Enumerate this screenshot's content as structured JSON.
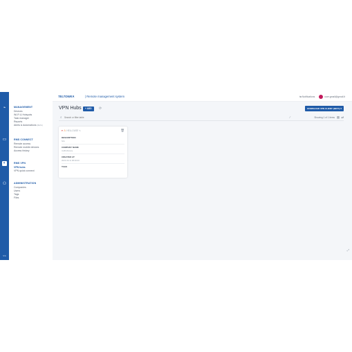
{
  "header": {
    "logo_text": "TELTONIKA",
    "app_title": "| Remote management system",
    "notifications_label": "Notifications",
    "user_email": "user.gmail@gmail.lt"
  },
  "sidebar": {
    "sections": [
      {
        "title": "MANAGEMENT",
        "items": [
          "Devices",
          "Wi-Fi & Hotspots",
          "Task manager",
          "Reports"
        ],
        "last_item": "Alerts & Automations",
        "beta": "(BETA)"
      },
      {
        "title": "RMS CONNECT",
        "items": [
          "Remote access",
          "Remote mobile devices",
          "Access history"
        ]
      },
      {
        "title": "RMS VPN",
        "items": [
          "VPN hubs",
          "VPN quick connect"
        ]
      },
      {
        "title": "ADMINISTRATION",
        "items": [
          "Companies",
          "Users",
          "Tags",
          "Files"
        ]
      }
    ],
    "collapse_label": "<<"
  },
  "main": {
    "page_title": "VPN Hubs",
    "add_label": "+ ADD",
    "download_label": "DOWNLOAD VPN CLIENT (BETA) ▾",
    "search_placeholder": "Search or filter table",
    "showing_text": "Showing 1 of 1 items",
    "card": {
      "hub_name": "HELLOUSE",
      "fields": [
        {
          "label": "DESCRIPTION",
          "value": "N/A"
        },
        {
          "label": "COMPANY NAME",
          "value": "UAB Ministre"
        },
        {
          "label": "CREATED AT",
          "value": "2023-09-11 08:00:00"
        },
        {
          "label": "TAGS",
          "value": ""
        }
      ]
    }
  },
  "colors": {
    "primary": "#1f5ba8",
    "background": "#f4f6f9",
    "warning": "#e67e22"
  },
  "icons": {
    "rail": [
      "devices-icon",
      "connect-icon",
      "vpn-icon",
      "users-icon"
    ]
  }
}
